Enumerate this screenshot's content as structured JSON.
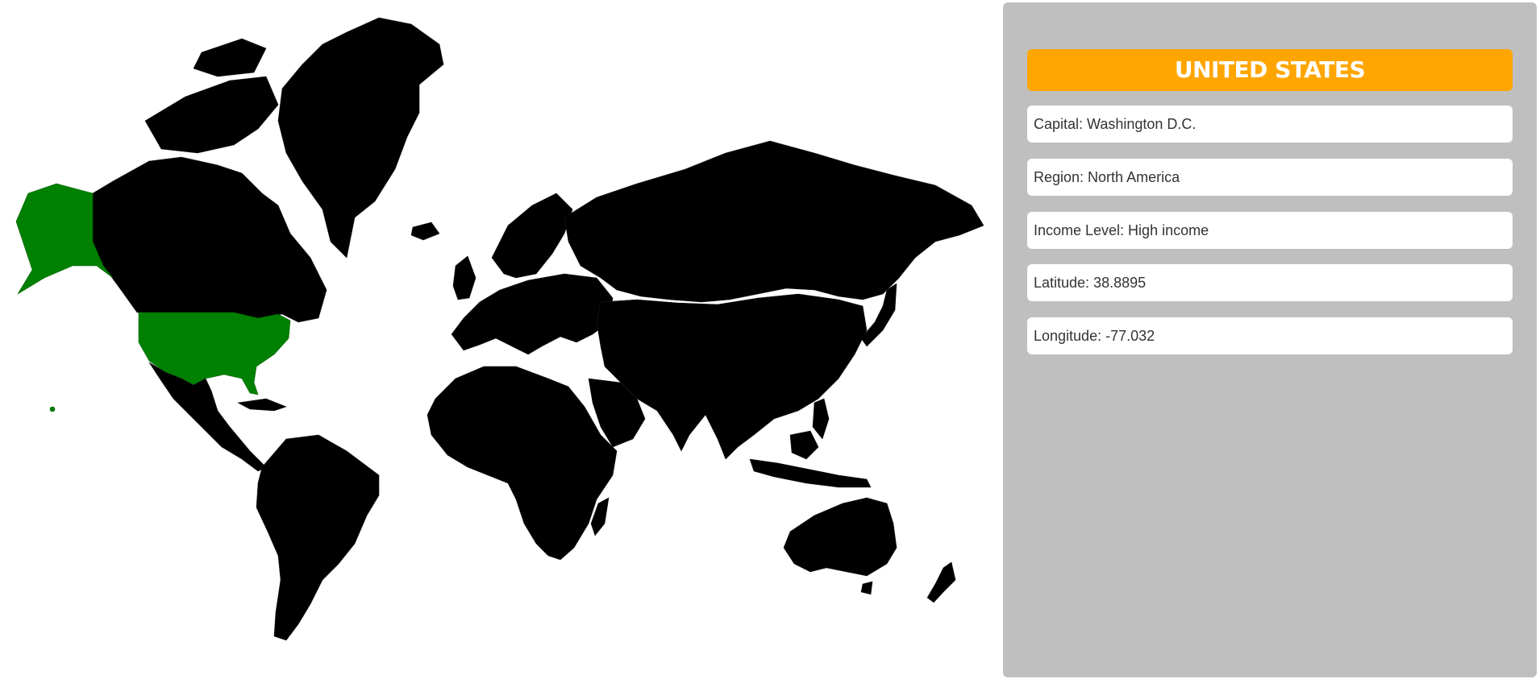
{
  "map": {
    "selected_country": "United States",
    "selected_color": "#008000",
    "land_color": "#000000",
    "background_color": "#ffffff"
  },
  "info_panel": {
    "title": "UNITED STATES",
    "title_color": "#ffa500",
    "panel_color": "#bfbfbf",
    "rows": [
      {
        "label": "Capital",
        "value": "Washington D.C.",
        "text": "Capital: Washington D.C."
      },
      {
        "label": "Region",
        "value": "North America",
        "text": "Region: North America"
      },
      {
        "label": "Income Level",
        "value": "High income",
        "text": "Income Level: High income"
      },
      {
        "label": "Latitude",
        "value": "38.8895",
        "text": "Latitude: 38.8895"
      },
      {
        "label": "Longitude",
        "value": "-77.032",
        "text": "Longitude: -77.032"
      }
    ]
  }
}
